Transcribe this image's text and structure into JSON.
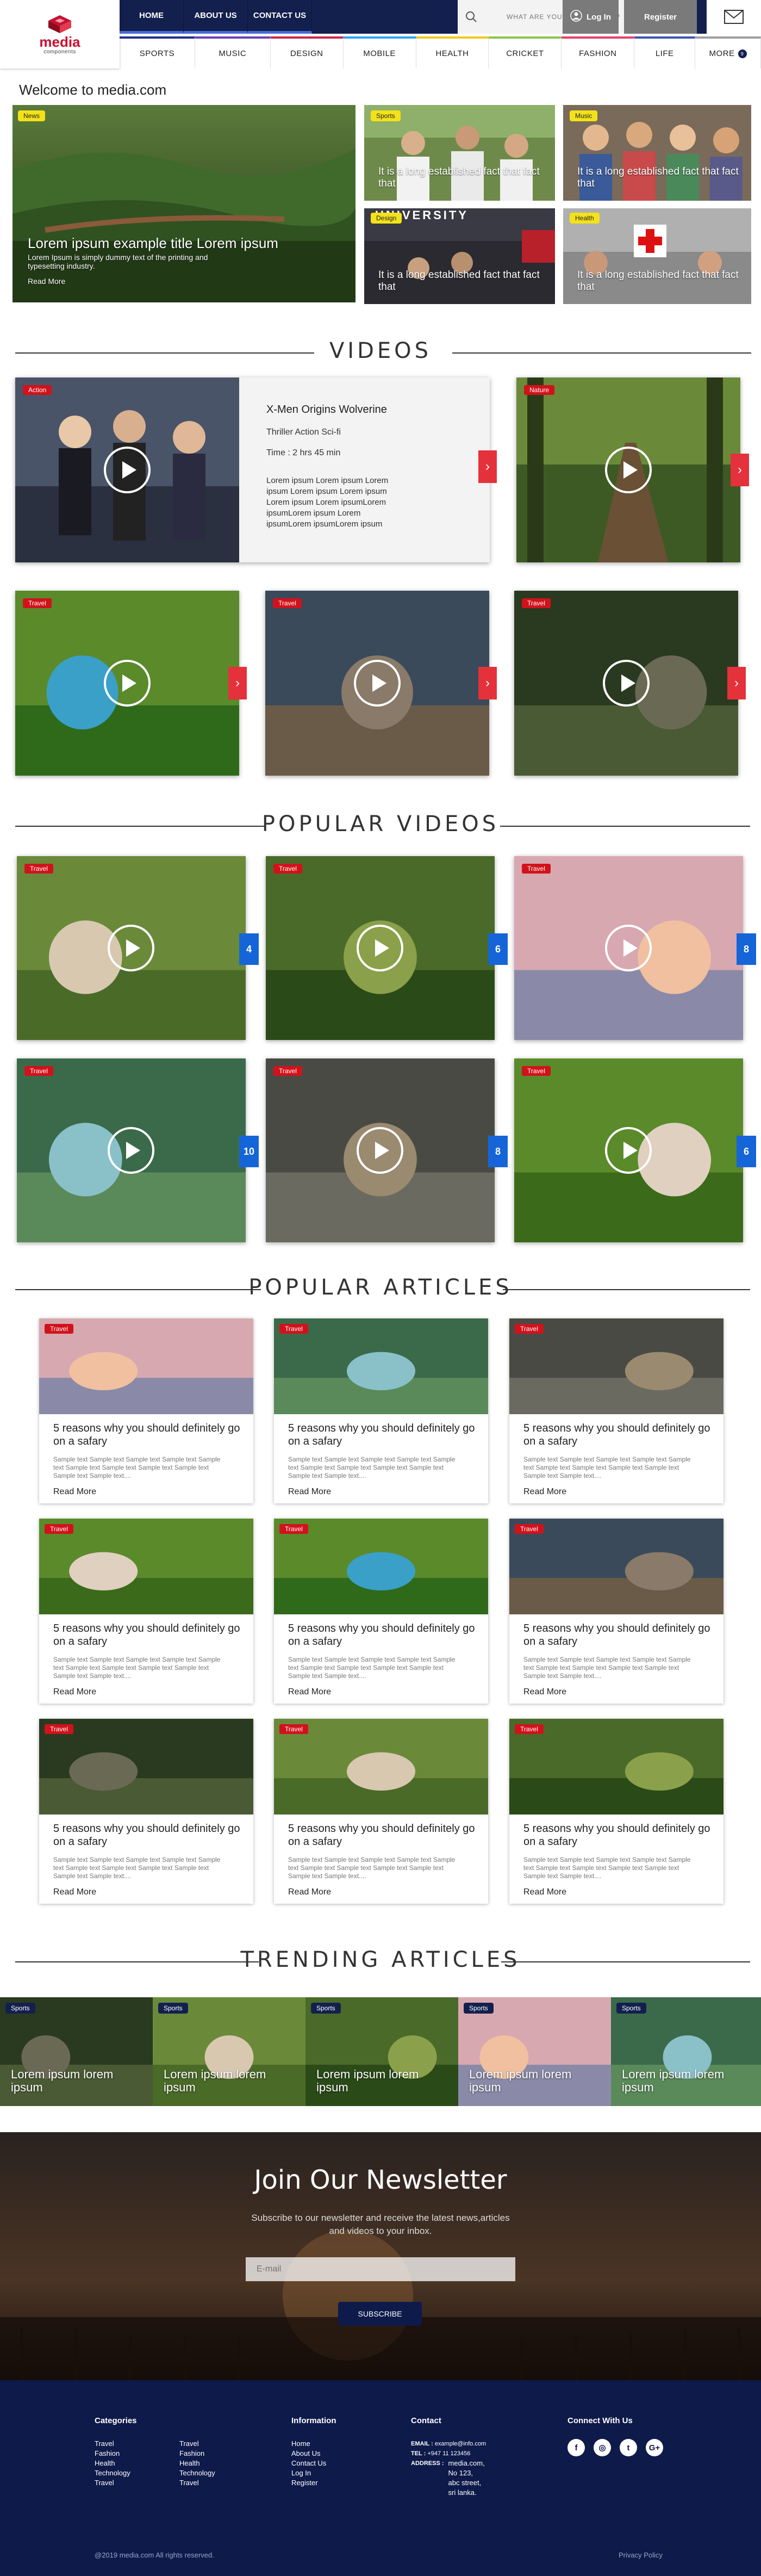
{
  "logo": {
    "name": "media",
    "sub": "components"
  },
  "topnav": {
    "home": "HOME",
    "about": "ABOUT US",
    "contact": "CONTACT US",
    "search_placeholder": "WHAT ARE YOU LOOKING FOR?",
    "login": "Log In",
    "register": "Register"
  },
  "categories": [
    {
      "label": "SPORTS",
      "color": "#1f2f8c"
    },
    {
      "label": "MUSIC",
      "color": "#6a3fb5"
    },
    {
      "label": "DESIGN",
      "color": "#c9284a"
    },
    {
      "label": "MOBILE",
      "color": "#2ea3f2"
    },
    {
      "label": "HEALTH",
      "color": "#f2c81b"
    },
    {
      "label": "CRICKET",
      "color": "#8bc34a"
    },
    {
      "label": "FASHION",
      "color": "#e53e6b"
    },
    {
      "label": "LIFE",
      "color": "#3f51b5"
    },
    {
      "label": "MORE",
      "color": "#9e9e9e"
    }
  ],
  "more_count": "9",
  "welcome": "Welcome to media.com",
  "hero": {
    "main": {
      "tag": "News",
      "title": "Lorem ipsum example title Lorem ipsum",
      "body": "Lorem Ipsum is simply dummy text of the printing and typesetting industry.",
      "more": "Read More"
    },
    "small": [
      {
        "tag": "Sports",
        "text": "It is a long established fact that fact that"
      },
      {
        "tag": "Music",
        "text": "It is a long established fact that fact that"
      },
      {
        "tag": "Design",
        "text": "It is a long established fact that fact that",
        "overlay": "UNIVERSITY"
      },
      {
        "tag": "Health",
        "text": "It is a long established fact that fact that"
      }
    ]
  },
  "videos": {
    "title": "VIDEOS",
    "featured": {
      "tag": "Action",
      "name": "X-Men Origins Wolverine",
      "genre": "Thriller Action Sci-fi",
      "time": "Time :  2 hrs 45 min",
      "desc": "Lorem ipsum Lorem ipsum Lorem ipsum Lorem ipsum Lorem ipsum Lorem ipsum Lorem ipsumLorem ipsumLorem ipsum Lorem ipsumLorem ipsumLorem ipsum"
    },
    "side_tag": "Nature",
    "row": [
      "Travel",
      "Travel",
      "Travel"
    ]
  },
  "popular_videos": {
    "title": "POPULAR VIDEOS",
    "items": [
      {
        "tag": "Travel",
        "count": "4"
      },
      {
        "tag": "Travel",
        "count": "6"
      },
      {
        "tag": "Travel",
        "count": "8"
      },
      {
        "tag": "Travel",
        "count": "10"
      },
      {
        "tag": "Travel",
        "count": "8"
      },
      {
        "tag": "Travel",
        "count": "6"
      }
    ]
  },
  "popular_articles": {
    "title": "POPULAR ARTICLES",
    "items": [
      {
        "tag": "Travel",
        "title": "5 reasons why you should definitely go on a safary",
        "body": "Sample text Sample text  Sample text  Sample text Sample text Sample text Sample text Sample text Sample text Sample text Sample text....",
        "more": "Read More"
      },
      {
        "tag": "Travel",
        "title": "5 reasons why you should definitely go on a safary",
        "body": "Sample text Sample text  Sample text  Sample text Sample text Sample text Sample text Sample text Sample text Sample text Sample text....",
        "more": "Read More"
      },
      {
        "tag": "Travel",
        "title": "5 reasons why you should definitely go on a safary",
        "body": "Sample text Sample text  Sample text  Sample text Sample text Sample text Sample text Sample text Sample text Sample text Sample text....",
        "more": "Read More"
      },
      {
        "tag": "Travel",
        "title": "5 reasons why you should definitely go on a safary",
        "body": "Sample text Sample text  Sample text  Sample text Sample text Sample text Sample text Sample text Sample text Sample text Sample text....",
        "more": "Read More"
      },
      {
        "tag": "Travel",
        "title": "5 reasons why you should definitely go on a safary",
        "body": "Sample text Sample text  Sample text  Sample text Sample text Sample text Sample text Sample text Sample text Sample text Sample text....",
        "more": "Read More"
      },
      {
        "tag": "Travel",
        "title": "5 reasons why you should definitely go on a safary",
        "body": "Sample text Sample text  Sample text  Sample text Sample text Sample text Sample text Sample text Sample text Sample text Sample text....",
        "more": "Read More"
      },
      {
        "tag": "Travel",
        "title": "5 reasons why you should definitely go on a safary",
        "body": "Sample text Sample text  Sample text  Sample text Sample text Sample text Sample text Sample text Sample text Sample text Sample text....",
        "more": "Read More"
      },
      {
        "tag": "Travel",
        "title": "5 reasons why you should definitely go on a safary",
        "body": "Sample text Sample text  Sample text  Sample text Sample text Sample text Sample text Sample text Sample text Sample text Sample text....",
        "more": "Read More"
      },
      {
        "tag": "Travel",
        "title": "5 reasons why you should definitely go on a safary",
        "body": "Sample text Sample text  Sample text  Sample text Sample text Sample text Sample text Sample text Sample text Sample text Sample text....",
        "more": "Read More"
      }
    ]
  },
  "trending": {
    "title": "TRENDING ARTICLES",
    "items": [
      {
        "tag": "Sports",
        "text": "Lorem ipsum lorem ipsum"
      },
      {
        "tag": "Sports",
        "text": "Lorem ipsum lorem ipsum"
      },
      {
        "tag": "Sports",
        "text": "Lorem ipsum lorem ipsum"
      },
      {
        "tag": "Sports",
        "text": "Lorem ipsum lorem ipsum"
      },
      {
        "tag": "Sports",
        "text": "Lorem ipsum lorem ipsum"
      }
    ]
  },
  "newsletter": {
    "title": "Join Our Newsletter",
    "subtitle1": "Subscribe to our newsletter and receive the latest news,articles",
    "subtitle2": "and videos to your inbox.",
    "placeholder": "E-mail",
    "button": "SUBSCRIBE"
  },
  "footer": {
    "categories_title": "Categories",
    "col1": [
      "Travel",
      "Fashion",
      "Health",
      "Technology",
      "Travel"
    ],
    "col2": [
      "Travel",
      "Fashion",
      "Health",
      "Technology",
      "Travel"
    ],
    "info_title": "Information",
    "info": [
      "Home",
      "About Us",
      "Contact Us",
      "Log In",
      "Register"
    ],
    "contact_title": "Contact",
    "email_label": "EMAIL :",
    "email": "example@info.com",
    "tel_label": "TEL :",
    "tel": "+947 11 123456",
    "address_label": "ADDRESS :",
    "address": [
      "media.com,",
      "No 123,",
      "abc street,",
      "sri lanka."
    ],
    "connect_title": "Connect With Us",
    "social": [
      {
        "icon": "facebook-icon",
        "glyph": "f"
      },
      {
        "icon": "instagram-icon",
        "glyph": "◎"
      },
      {
        "icon": "twitter-icon",
        "glyph": "t"
      },
      {
        "icon": "google-plus-icon",
        "glyph": "G+"
      }
    ],
    "copyright": "@2019 media.com All rights reserved.",
    "privacy": "Privacy Policy"
  }
}
